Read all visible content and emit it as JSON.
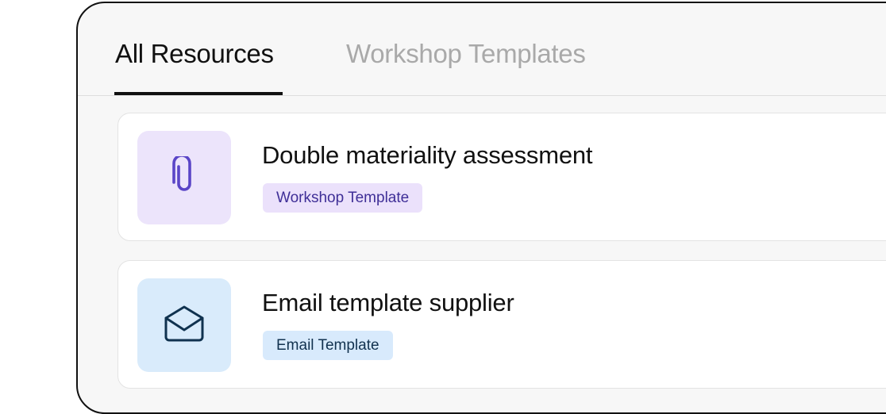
{
  "tabs": [
    {
      "label": "All Resources",
      "active": true
    },
    {
      "label": "Workshop Templates",
      "active": false
    }
  ],
  "resources": [
    {
      "title": "Double materiality assessment",
      "tag": "Workshop Template",
      "icon": "paperclip-icon",
      "accent": "#5a45c7",
      "tile_color": "#ece4fb"
    },
    {
      "title": "Email template supplier",
      "tag": "Email Template",
      "icon": "envelope-open-icon",
      "accent": "#10324f",
      "tile_color": "#d9ebfb"
    }
  ]
}
